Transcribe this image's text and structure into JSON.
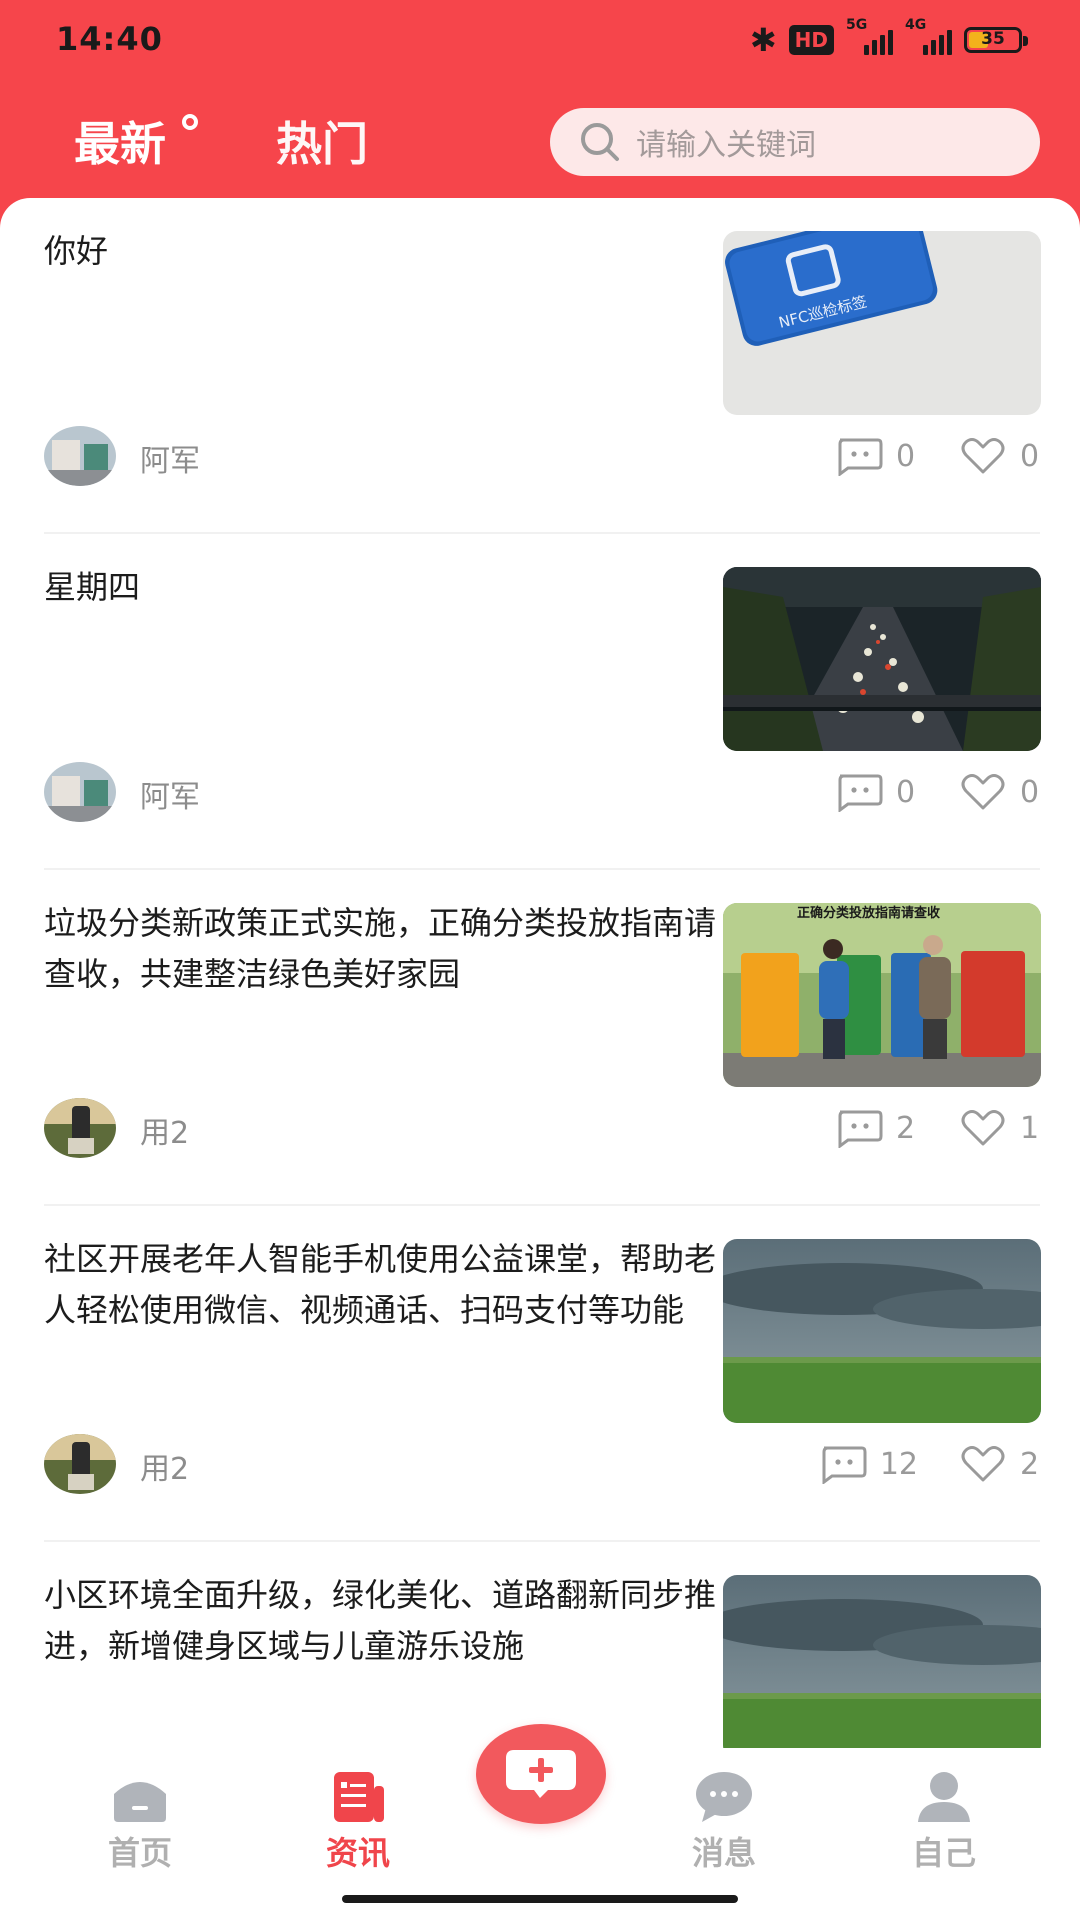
{
  "status_bar": {
    "time": "14:40",
    "hd_label": "HD",
    "net_5g": "5G",
    "net_4g": "4G",
    "battery": "35"
  },
  "header": {
    "tabs": [
      {
        "label": "最新"
      },
      {
        "label": "热门"
      }
    ],
    "search_placeholder": "请输入关键词"
  },
  "feed": [
    {
      "title": "你好",
      "author": "阿军",
      "comments": "0",
      "likes": "0",
      "thumb_icon": "nfc-tag-photo",
      "thumb_text": "NFC巡检标签"
    },
    {
      "title": "星期四",
      "author": "阿军",
      "comments": "0",
      "likes": "0",
      "thumb_icon": "night-traffic-photo"
    },
    {
      "title": "垃圾分类新政策正式实施，正确分类投放指南请查收，共建整洁绿色美好家园",
      "author": "用2",
      "comments": "2",
      "likes": "1",
      "thumb_icon": "garbage-sorting-photo",
      "thumb_text": "正确分类投放指南请查收"
    },
    {
      "title": "社区开展老年人智能手机使用公益课堂，帮助老人轻松使用微信、视频通话、扫码支付等功能",
      "author": "用2",
      "comments": "12",
      "likes": "2",
      "thumb_icon": "grassland-storm-photo"
    },
    {
      "title": "小区环境全面升级，绿化美化、道路翻新同步推进，新增健身区域与儿童游乐设施",
      "author": "",
      "comments": "",
      "likes": "",
      "thumb_icon": "grassland-storm-photo"
    }
  ],
  "bottom_nav": {
    "items": [
      {
        "label": "首页",
        "icon": "home-icon"
      },
      {
        "label": "资讯",
        "icon": "news-icon"
      },
      {
        "label": "消息",
        "icon": "message-icon"
      },
      {
        "label": "自己",
        "icon": "profile-icon"
      }
    ],
    "fab_icon": "add-post-icon"
  },
  "colors": {
    "brand": "#f6454b",
    "active_nav": "#f0454b",
    "inactive_nav": "#b0b0b0"
  }
}
